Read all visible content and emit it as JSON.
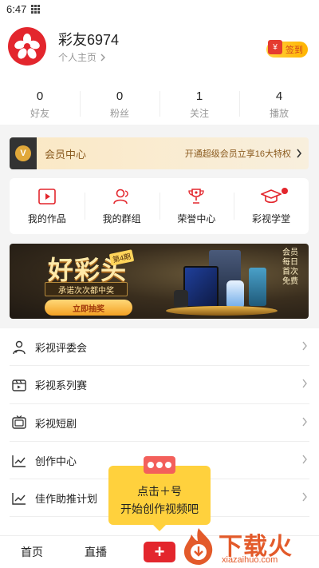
{
  "status": {
    "time": "6:47"
  },
  "profile": {
    "username": "彩友6974",
    "homepage_link": "个人主页",
    "signin_label": "签到",
    "signin_gift_glyph": "¥"
  },
  "stats": [
    {
      "value": "0",
      "label": "好友"
    },
    {
      "value": "0",
      "label": "粉丝"
    },
    {
      "value": "1",
      "label": "关注"
    },
    {
      "value": "4",
      "label": "播放"
    }
  ],
  "vip": {
    "badge": "V",
    "title": "会员中心",
    "promo": "开通超级会员立享16大特权"
  },
  "features": [
    {
      "label": "我的作品",
      "icon": "video-frame-icon"
    },
    {
      "label": "我的群组",
      "icon": "group-icon"
    },
    {
      "label": "荣誉中心",
      "icon": "trophy-icon"
    },
    {
      "label": "彩视学堂",
      "icon": "graduation-cap-icon",
      "has_dot": true
    }
  ],
  "banner": {
    "title": "好彩头",
    "issue": "第4期",
    "subtitle": "承诺次次都中奖",
    "button": "立即抽奖",
    "side_text": "会员每日首次免费"
  },
  "menu": [
    {
      "label": "彩视评委会",
      "icon": "jury-icon"
    },
    {
      "label": "彩视系列赛",
      "icon": "series-icon"
    },
    {
      "label": "彩视短剧",
      "icon": "tv-icon"
    },
    {
      "label": "创作中心",
      "icon": "chart-line-icon"
    },
    {
      "label": "佳作助推计划",
      "icon": "chart-line-icon"
    }
  ],
  "tabbar": {
    "home": "首页",
    "live": "直播",
    "plus": "+"
  },
  "tooltip": {
    "line1": "点击＋号",
    "line2": "开始创作视频吧"
  },
  "watermark": {
    "brand": "下载火",
    "url": "xiazaihuo.com"
  },
  "colors": {
    "brand_red": "#e3262d",
    "vip_text": "#8a5a1e",
    "tooltip_bg": "#ffd13d"
  }
}
